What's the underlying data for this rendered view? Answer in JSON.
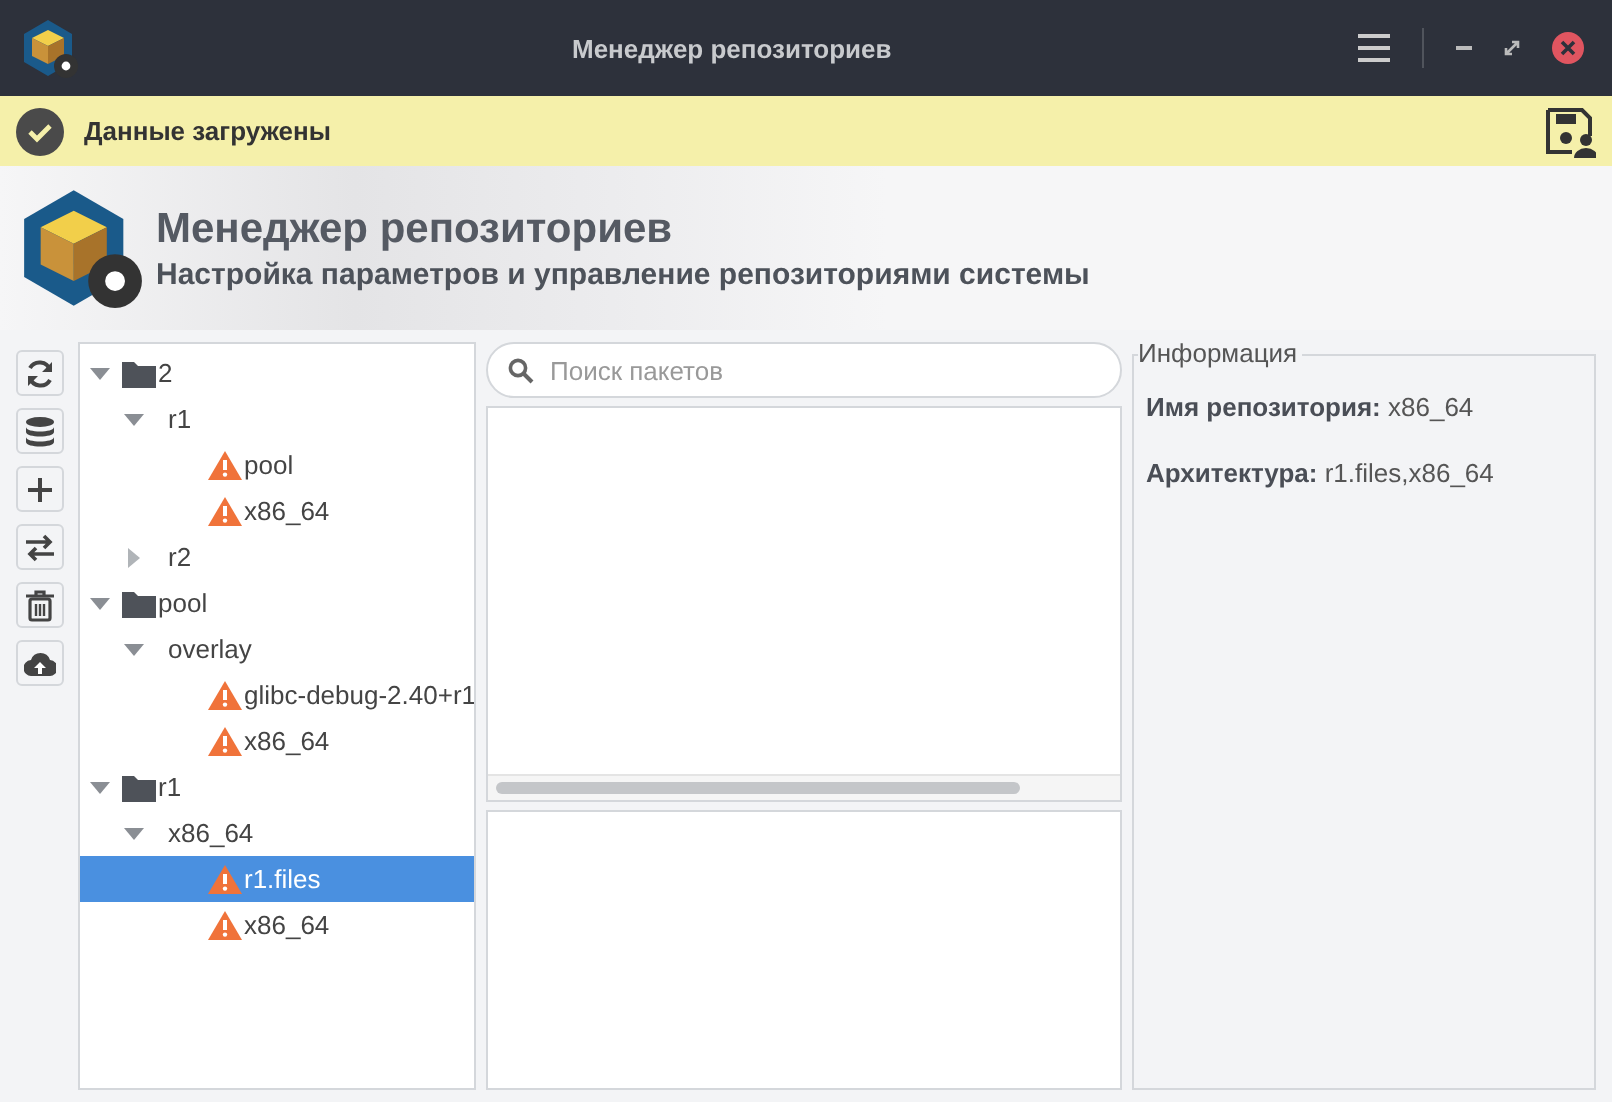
{
  "window": {
    "title": "Менеджер репозиториев"
  },
  "notification": {
    "text": "Данные загружены"
  },
  "header": {
    "title": "Менеджер репозиториев",
    "subtitle": "Настройка параметров и управление репозиториями системы"
  },
  "tree": [
    {
      "label": "2",
      "kind": "folder",
      "expanded": true,
      "selected": false,
      "children": [
        {
          "label": "r1",
          "kind": "group",
          "expanded": true,
          "selected": false,
          "children": [
            {
              "label": "pool",
              "kind": "warning",
              "selected": false
            },
            {
              "label": "x86_64",
              "kind": "warning",
              "selected": false
            }
          ]
        },
        {
          "label": "r2",
          "kind": "group",
          "expanded": false,
          "selected": false
        }
      ]
    },
    {
      "label": "pool",
      "kind": "folder",
      "expanded": true,
      "selected": false,
      "children": [
        {
          "label": "overlay",
          "kind": "group",
          "expanded": true,
          "selected": false,
          "children": [
            {
              "label": "glibc-debug-2.40+r1",
              "kind": "warning",
              "selected": false
            },
            {
              "label": "x86_64",
              "kind": "warning",
              "selected": false
            }
          ]
        }
      ]
    },
    {
      "label": "r1",
      "kind": "folder",
      "expanded": true,
      "selected": false,
      "children": [
        {
          "label": "x86_64",
          "kind": "group",
          "expanded": true,
          "selected": false,
          "children": [
            {
              "label": "r1.files",
              "kind": "warning",
              "selected": true
            },
            {
              "label": "x86_64",
              "kind": "warning",
              "selected": false
            }
          ]
        }
      ]
    }
  ],
  "search": {
    "placeholder": "Поиск пакетов"
  },
  "info": {
    "title": "Информация",
    "lines": [
      "**Имя репозитория:** x86_64",
      "**Архитектура:** r1.files,x86_64"
    ]
  }
}
